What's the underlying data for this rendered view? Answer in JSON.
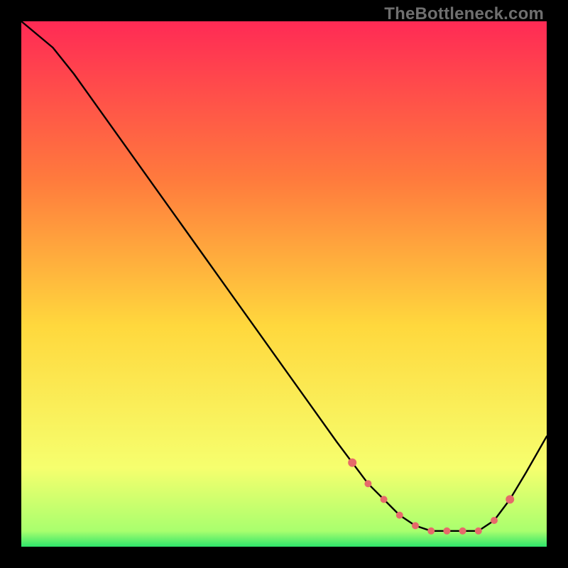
{
  "watermark": "TheBottleneck.com",
  "colors": {
    "background": "#000000",
    "gradient_top": "#ff2a55",
    "gradient_mid_upper": "#ff7a3d",
    "gradient_mid": "#ffd83d",
    "gradient_lower": "#f6ff6e",
    "gradient_bottom": "#2fe56b",
    "line": "#000000",
    "marker": "#e66a6a"
  },
  "chart_data": {
    "type": "line",
    "title": "",
    "xlabel": "",
    "ylabel": "",
    "xlim": [
      0,
      100
    ],
    "ylim": [
      0,
      100
    ],
    "series": [
      {
        "name": "curve",
        "x": [
          0,
          6,
          10,
          15,
          20,
          25,
          30,
          35,
          40,
          45,
          50,
          55,
          60,
          63,
          66,
          69,
          72,
          75,
          78,
          81,
          84,
          87,
          90,
          93,
          96,
          100
        ],
        "y": [
          100,
          95,
          90,
          83,
          76,
          69,
          62,
          55,
          48,
          41,
          34,
          27,
          20,
          16,
          12,
          9,
          6,
          4,
          3,
          3,
          3,
          3,
          5,
          9,
          14,
          21
        ]
      }
    ],
    "markers": {
      "name": "highlight",
      "x": [
        63,
        66,
        69,
        72,
        75,
        78,
        81,
        84,
        87,
        90,
        93
      ],
      "y": [
        16,
        12,
        9,
        6,
        4,
        3,
        3,
        3,
        3,
        5,
        9
      ],
      "size_first_last": 6,
      "size_mid": 5
    }
  }
}
